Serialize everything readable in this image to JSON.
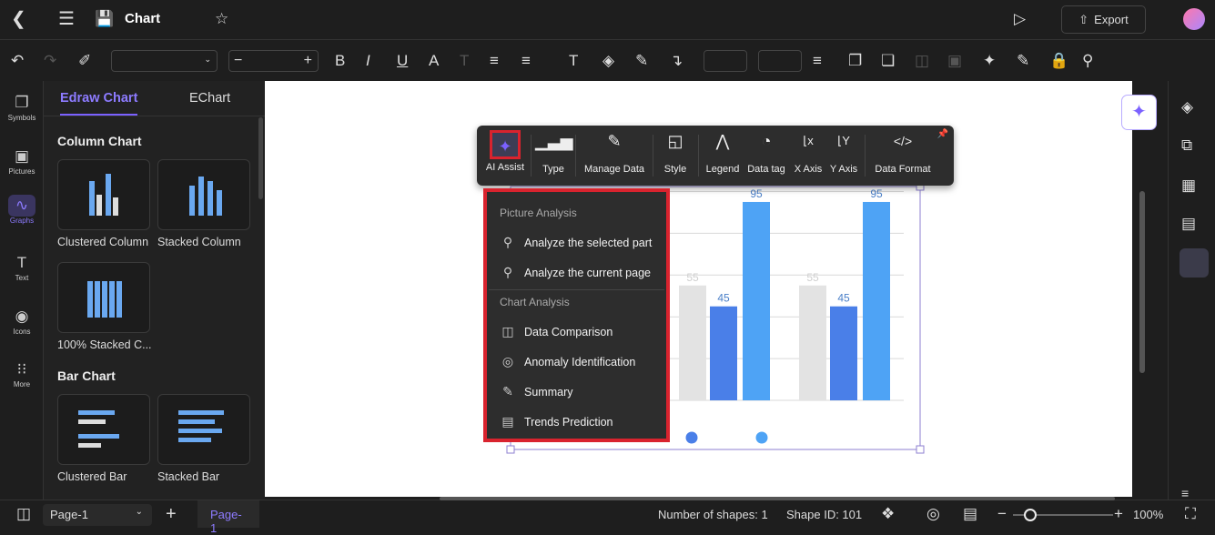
{
  "header": {
    "title": "Chart",
    "export_label": "Export"
  },
  "toolbar": {
    "font_value": "",
    "size_value": ""
  },
  "left_sidebar": {
    "items": [
      {
        "label": "Symbols",
        "icon": "symbols-icon"
      },
      {
        "label": "Pictures",
        "icon": "picture-icon"
      },
      {
        "label": "Graphs",
        "icon": "graph-icon"
      },
      {
        "label": "Text",
        "icon": "text-icon"
      },
      {
        "label": "Icons",
        "icon": "icons-icon"
      },
      {
        "label": "More",
        "icon": "grid-dots-icon"
      }
    ]
  },
  "panel": {
    "tabs": [
      "Edraw Chart",
      "EChart"
    ],
    "sections": [
      {
        "title": "Column Chart",
        "items": [
          "Clustered Column",
          "Stacked Column",
          "100% Stacked C..."
        ]
      },
      {
        "title": "Bar Chart",
        "items": [
          "Clustered Bar",
          "Stacked Bar"
        ]
      }
    ]
  },
  "chart_toolbar": {
    "items": [
      "AI Assist",
      "Type",
      "Manage Data",
      "Style",
      "Legend",
      "Data tag",
      "X Axis",
      "Y Axis",
      "Data Format"
    ]
  },
  "ai_menu": {
    "picture_heading": "Picture Analysis",
    "picture_items": [
      "Analyze the selected part",
      "Analyze the current page"
    ],
    "chart_heading": "Chart Analysis",
    "chart_items": [
      "Data Comparison",
      "Anomaly Identification",
      "Summary",
      "Trends Prediction"
    ]
  },
  "chart_data": {
    "type": "bar",
    "ylim": [
      0,
      100
    ],
    "grid": true,
    "groups": [
      {
        "values": [
          55,
          45,
          95
        ]
      },
      {
        "values": [
          55,
          45,
          95
        ]
      }
    ],
    "colors": [
      "#e3e3e3",
      "#4a7fe8",
      "#4ea3f5"
    ],
    "legend_dot_colors": [
      "#4a7fe8",
      "#4ea3f5"
    ]
  },
  "status": {
    "page_tab": "Page-1",
    "page_active": "Page-1",
    "shape_count": "Number of shapes: 1",
    "shape_id": "Shape ID: 101",
    "zoom": "100%"
  },
  "colors": {
    "accent": "#7b61ff",
    "highlight": "#d9232e"
  }
}
